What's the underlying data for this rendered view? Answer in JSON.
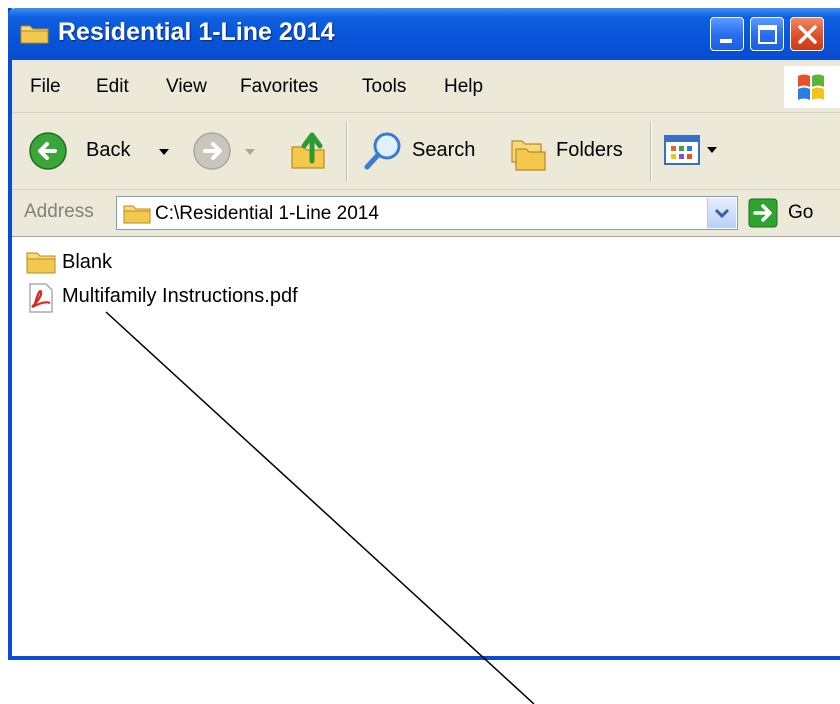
{
  "window": {
    "title": "Residential 1-Line 2014"
  },
  "menu": {
    "items": [
      "File",
      "Edit",
      "View",
      "Favorites",
      "Tools",
      "Help"
    ]
  },
  "toolbar": {
    "back_label": "Back",
    "search_label": "Search",
    "folders_label": "Folders"
  },
  "address": {
    "label": "Address",
    "value": "C:\\Residential 1-Line 2014",
    "go_label": "Go"
  },
  "files": [
    {
      "name": "Blank",
      "icon": "folder-icon"
    },
    {
      "name": "Multifamily Instructions.pdf",
      "icon": "pdf-icon"
    }
  ],
  "colors": {
    "titlebar": "#0a4cd6",
    "chrome": "#ece9d8",
    "close_button": "#e0532b",
    "go_arrow": "#2fa32f",
    "folder": "#f2c94c"
  }
}
